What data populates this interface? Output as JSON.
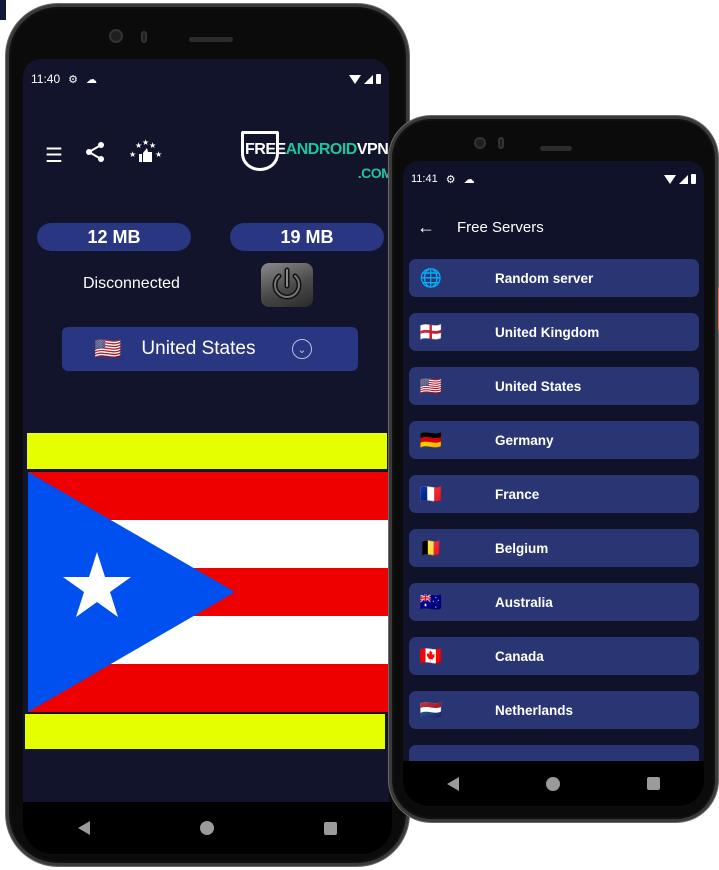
{
  "left_phone": {
    "status_bar": {
      "time": "11:40",
      "icons": [
        "gear-icon",
        "cloud-icon"
      ],
      "right_icons": [
        "wifi-icon",
        "signal-icon",
        "battery-icon"
      ]
    },
    "toolbar": {
      "icons": [
        {
          "name": "list-icon",
          "glyph": "☰"
        },
        {
          "name": "share-icon",
          "glyph": "⋖"
        },
        {
          "name": "rate-icon",
          "glyph": "👍"
        }
      ]
    },
    "logo": {
      "free": "FREE",
      "android": "ANDROID",
      "vpn": "VPN",
      "com": ".COM"
    },
    "usage": {
      "download": "12 MB",
      "upload": "19 MB"
    },
    "connection_status": "Disconnected",
    "selected_country": {
      "flag": "🇺🇸",
      "name": "United States"
    },
    "banner": {
      "stripe_color": "#e6ff00",
      "flag_colors": {
        "red": "#ee0000",
        "white": "#ffffff",
        "blue": "#0050ef"
      }
    },
    "nav": [
      "back",
      "home",
      "recents"
    ]
  },
  "right_phone": {
    "status_bar": {
      "time": "11:41"
    },
    "header": {
      "title": "Free Servers"
    },
    "servers": [
      {
        "flag": "🌐",
        "name": "Random server"
      },
      {
        "flag": "🏴󠁧󠁢󠁥󠁮󠁧󠁿",
        "name": "United Kingdom"
      },
      {
        "flag": "🇺🇸",
        "name": "United States"
      },
      {
        "flag": "🇩🇪",
        "name": "Germany"
      },
      {
        "flag": "🇫🇷",
        "name": "France"
      },
      {
        "flag": "🇧🇪",
        "name": "Belgium"
      },
      {
        "flag": "🇦🇺",
        "name": "Australia"
      },
      {
        "flag": "🇨🇦",
        "name": "Canada"
      },
      {
        "flag": "🇳🇱",
        "name": "Netherlands"
      }
    ]
  },
  "colors": {
    "screen_bg": "#11142a",
    "accent_pill": "#293682",
    "list_item": "#293673",
    "logo_green": "#22c59a"
  }
}
